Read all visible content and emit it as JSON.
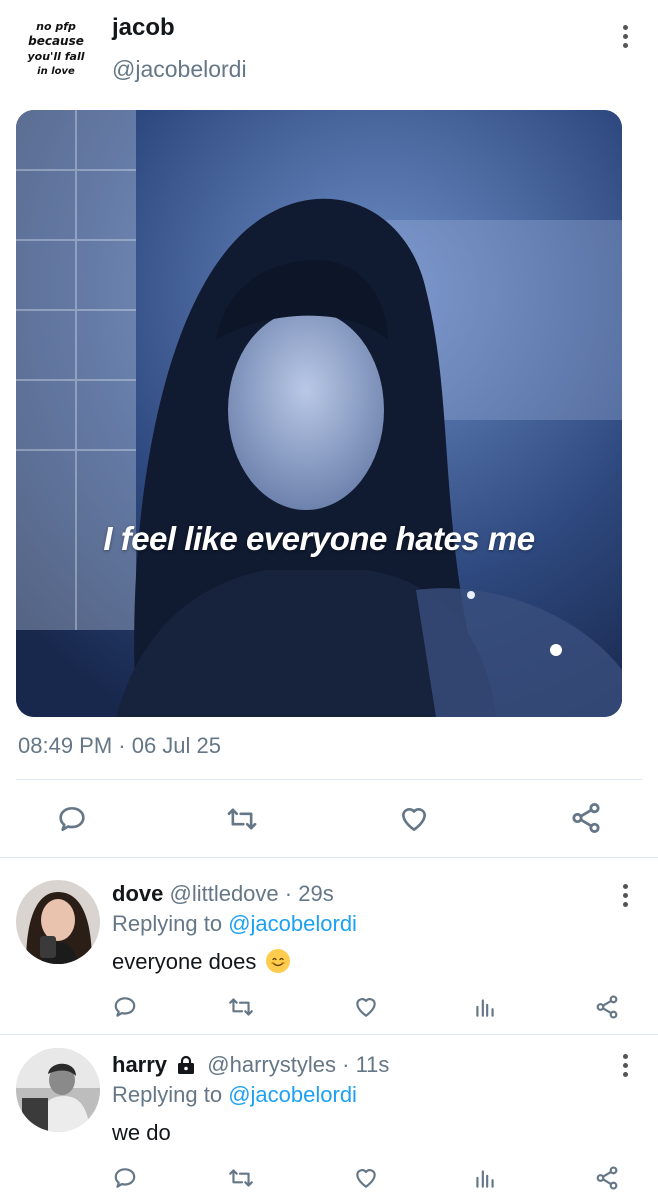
{
  "tweet": {
    "avatar_text": [
      "no pfp",
      "because",
      "you'll fall",
      "in love"
    ],
    "display_name": "jacob",
    "handle": "@jacobelordi",
    "media_caption": "I feel like everyone hates me",
    "timestamp": "08:49 PM · 06 Jul 25",
    "actions": [
      "reply-icon",
      "retweet-icon",
      "like-icon",
      "share-icon"
    ]
  },
  "replies": [
    {
      "display_name": "dove",
      "handle": "@littledove",
      "time": "· 29s",
      "replying_prefix": "Replying to",
      "replying_to": "@jacobelordi",
      "text": "everyone does",
      "emoji": "smiling-face-emoji",
      "protected": false
    },
    {
      "display_name": "harry",
      "handle": "@harrystyles",
      "time": "· 11s",
      "replying_prefix": "Replying to",
      "replying_to": "@jacobelordi",
      "text": "we do",
      "protected": true
    }
  ],
  "colors": {
    "accent": "#1da1f2",
    "secondary_text": "#657786",
    "divider": "#e1e8ed"
  }
}
